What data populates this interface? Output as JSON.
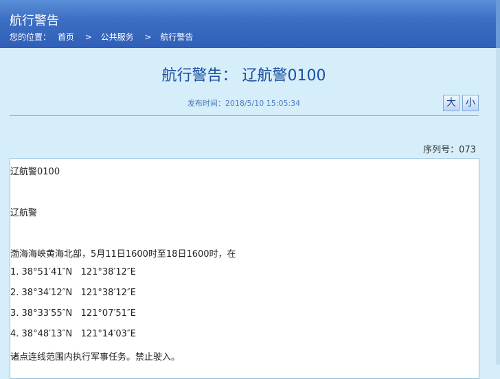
{
  "header": {
    "title": "航行警告",
    "breadcrumb_prefix": "您的位置：",
    "breadcrumbs": [
      "首页",
      "公共服务",
      "航行警告"
    ],
    "separator": ">"
  },
  "article": {
    "title": "航行警告： 辽航警0100",
    "publish_label": "发布时间：2018/5/10 15:05:34",
    "font_large": "大",
    "font_small": "小",
    "serial": "序列号：073",
    "lines": [
      "辽航警0100",
      "辽航警",
      "渤海海峡黄海北部，5月11日1600时至18日1600时，在",
      "1. 38°51′41″N   121°38′12″E",
      "2. 38°34′12″N   121°38′12″E",
      "3. 38°33′55″N   121°07′51″E",
      "4. 38°48′13″N   121°14′03″E",
      "诸点连线范围内执行军事任务。禁止驶入。"
    ]
  }
}
